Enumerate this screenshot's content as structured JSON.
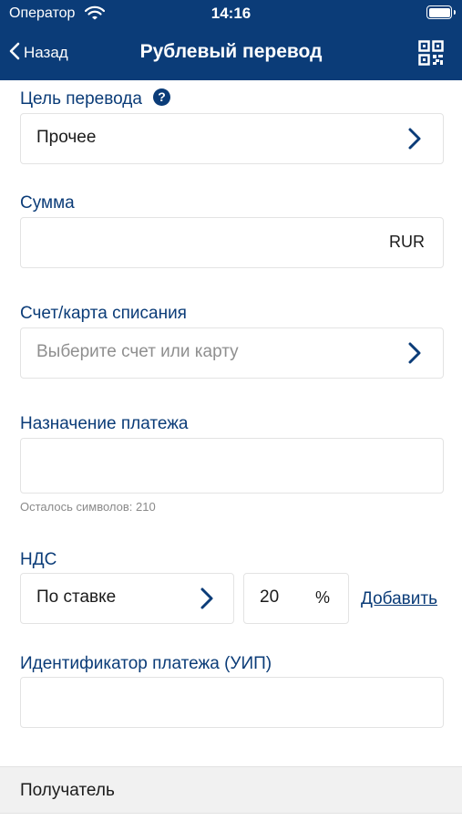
{
  "status_bar": {
    "carrier": "Оператор",
    "time": "14:16"
  },
  "nav": {
    "back_label": "Назад",
    "title": "Рублевый перевод"
  },
  "purpose": {
    "label": "Цель перевода",
    "value": "Прочее"
  },
  "amount": {
    "label": "Сумма",
    "value": "",
    "currency": "RUR"
  },
  "account": {
    "label": "Счет/карта списания",
    "placeholder": "Выберите счет или карту"
  },
  "payment_purpose": {
    "label": "Назначение платежа",
    "value": "",
    "hint": "Осталось символов: 210"
  },
  "vat": {
    "label": "НДС",
    "mode": "По ставке",
    "rate": "20",
    "unit": "%",
    "add_label": "Добавить"
  },
  "uip": {
    "label": "Идентификатор платежа (УИП)",
    "value": ""
  },
  "recipient_section": {
    "label": "Получатель"
  },
  "colors": {
    "primary": "#0b3c78",
    "border": "#e3e3e3",
    "section_bg": "#f1f1f1",
    "placeholder": "#8f8f8f"
  }
}
